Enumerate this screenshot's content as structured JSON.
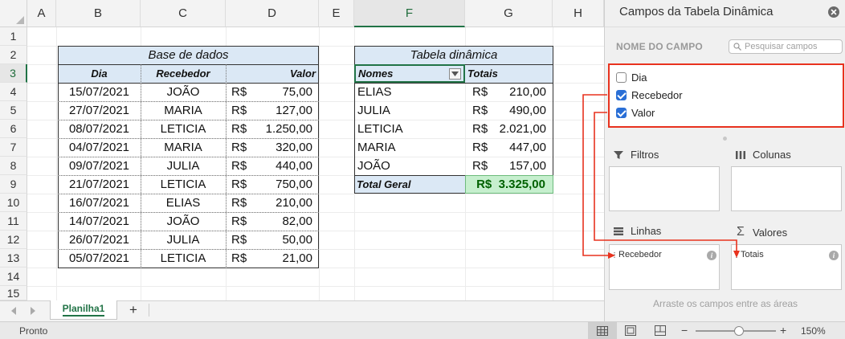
{
  "sheet": {
    "columns": [
      "A",
      "B",
      "C",
      "D",
      "E",
      "F",
      "G",
      "H"
    ],
    "rows": [
      "1",
      "2",
      "3",
      "4",
      "5",
      "6",
      "7",
      "8",
      "9",
      "10",
      "11",
      "12",
      "13",
      "14",
      "15"
    ],
    "db": {
      "title": "Base de dados",
      "headers": {
        "dia": "Dia",
        "recebedor": "Recebedor",
        "valor": "Valor"
      },
      "currency": "R$",
      "rows": [
        {
          "dia": "15/07/2021",
          "rec": "JOÃO",
          "val": "75,00"
        },
        {
          "dia": "27/07/2021",
          "rec": "MARIA",
          "val": "127,00"
        },
        {
          "dia": "08/07/2021",
          "rec": "LETICIA",
          "val": "1.250,00"
        },
        {
          "dia": "04/07/2021",
          "rec": "MARIA",
          "val": "320,00"
        },
        {
          "dia": "09/07/2021",
          "rec": "JULIA",
          "val": "440,00"
        },
        {
          "dia": "21/07/2021",
          "rec": "LETICIA",
          "val": "750,00"
        },
        {
          "dia": "16/07/2021",
          "rec": "ELIAS",
          "val": "210,00"
        },
        {
          "dia": "14/07/2021",
          "rec": "JOÃO",
          "val": "82,00"
        },
        {
          "dia": "26/07/2021",
          "rec": "JULIA",
          "val": "50,00"
        },
        {
          "dia": "05/07/2021",
          "rec": "LETICIA",
          "val": "21,00"
        }
      ]
    },
    "pivot": {
      "title": "Tabela dinâmica",
      "headers": {
        "nomes": "Nomes",
        "totais": "Totais"
      },
      "currency": "R$",
      "rows": [
        {
          "nome": "ELIAS",
          "val": "210,00"
        },
        {
          "nome": "JULIA",
          "val": "490,00"
        },
        {
          "nome": "LETICIA",
          "val": "2.021,00"
        },
        {
          "nome": "MARIA",
          "val": "447,00"
        },
        {
          "nome": "JOÃO",
          "val": "157,00"
        }
      ],
      "total_label": "Total Geral",
      "total_value": "R$  3.325,00"
    }
  },
  "tabs": {
    "sheet_name": "Planilha1",
    "add": "+"
  },
  "status": {
    "left": "Pronto",
    "zoom": "150%",
    "minus": "−",
    "plus": "+"
  },
  "panel": {
    "title": "Campos da Tabela Dinâmica",
    "field_name": "NOME DO CAMPO",
    "search_placeholder": "Pesquisar campos",
    "fields": [
      {
        "label": "Dia",
        "checked": false
      },
      {
        "label": "Recebedor",
        "checked": true
      },
      {
        "label": "Valor",
        "checked": true
      }
    ],
    "areas": {
      "filtros": "Filtros",
      "colunas": "Colunas",
      "linhas": "Linhas",
      "valores": "Valores"
    },
    "linhas_item": "Recebedor",
    "valores_item": "Totais",
    "hint": "Arraste os campos entre as áreas"
  },
  "colors": {
    "accent": "#217346",
    "highlight": "#e8321e",
    "header_fill": "#dbe8f5",
    "total_fill": "#c6efce",
    "total_text": "#006100"
  }
}
